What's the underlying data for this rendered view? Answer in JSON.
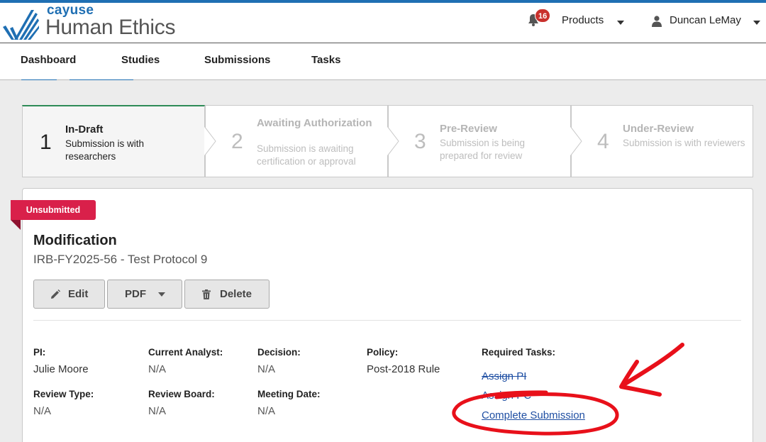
{
  "brand": {
    "small": "cayuse",
    "product": "Human Ethics"
  },
  "header": {
    "notifications_count": "16",
    "products_label": "Products",
    "user_name": "Duncan LeMay"
  },
  "nav": {
    "items": [
      {
        "label": "Dashboard"
      },
      {
        "label": "Studies"
      },
      {
        "label": "Submissions"
      },
      {
        "label": "Tasks"
      }
    ]
  },
  "stepper": {
    "steps": [
      {
        "num": "1",
        "title": "In-Draft",
        "sub": "Submission is with researchers",
        "active": true
      },
      {
        "num": "2",
        "title": "Awaiting Authorization",
        "sub": "Submission is awaiting certification or approval",
        "active": false
      },
      {
        "num": "3",
        "title": "Pre-Review",
        "sub": "Submission is being prepared for review",
        "active": false
      },
      {
        "num": "4",
        "title": "Under-Review",
        "sub": "Submission is with reviewers",
        "active": false
      }
    ]
  },
  "submission": {
    "status": "Unsubmitted",
    "type": "Modification",
    "identifier": "IRB-FY2025-56 - Test Protocol 9",
    "buttons": {
      "edit": "Edit",
      "pdf": "PDF",
      "delete": "Delete"
    },
    "fields": {
      "pi_label": "PI:",
      "pi_value": "Julie Moore",
      "analyst_label": "Current Analyst:",
      "analyst_value": "N/A",
      "decision_label": "Decision:",
      "decision_value": "N/A",
      "policy_label": "Policy:",
      "policy_value": "Post-2018 Rule",
      "review_type_label": "Review Type:",
      "review_type_value": "N/A",
      "review_board_label": "Review Board:",
      "review_board_value": "N/A",
      "meeting_date_label": "Meeting Date:",
      "meeting_date_value": "N/A"
    },
    "required_tasks": {
      "label": "Required Tasks:",
      "items": [
        {
          "label": "Assign PI",
          "done": true
        },
        {
          "label": "Assign PC",
          "done": true
        },
        {
          "label": "Complete Submission",
          "done": false
        }
      ]
    }
  },
  "colors": {
    "brand_blue": "#1f6fb3",
    "ribbon_red": "#d9204a",
    "annotation_red": "#e8101a",
    "active_step_green": "#2e8b57"
  }
}
